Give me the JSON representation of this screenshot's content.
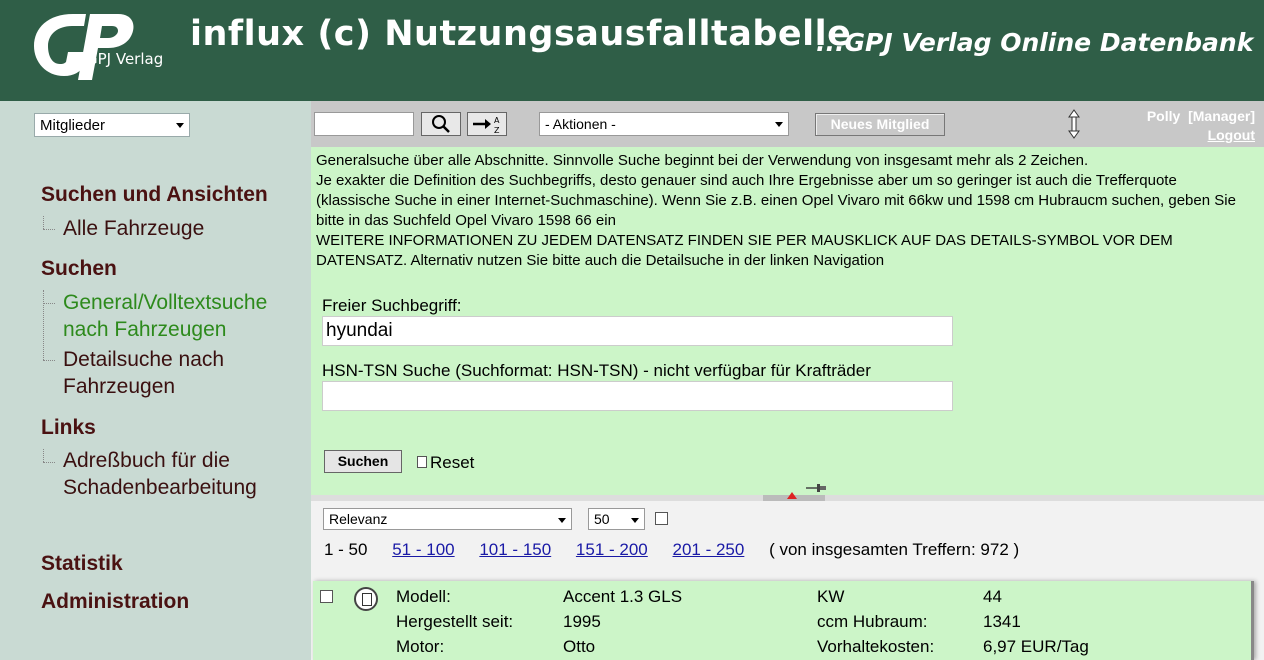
{
  "header": {
    "logo_text": "GPJ Verlag",
    "title": "influx (c) Nutzungsausfalltabelle",
    "subtitle": "...GPJ Verlag Online Datenbank"
  },
  "sidebar": {
    "members_select": "Mitglieder",
    "sections": [
      {
        "heading": "Suchen und Ansichten",
        "items": [
          "Alle Fahrzeuge"
        ]
      },
      {
        "heading": "Suchen",
        "items": [
          "General/Volltextsuche nach Fahrzeugen",
          "Detailsuche nach Fahrzeugen"
        ]
      },
      {
        "heading": "Links",
        "items": [
          "Adreßbuch für die Schadenbearbeitung"
        ]
      },
      {
        "heading": "Statistik",
        "items": []
      },
      {
        "heading": "Administration",
        "items": []
      }
    ]
  },
  "toolbar": {
    "search_value": "",
    "actions_select": "- Aktionen -",
    "new_member_label": "Neues Mitglied",
    "user_name": "Polly",
    "user_role": "[Manager]",
    "logout_label": "Logout"
  },
  "search": {
    "info_lines": [
      "Generalsuche über alle Abschnitte. Sinnvolle Suche beginnt bei der Verwendung von insgesamt mehr als 2 Zeichen.",
      "Je exakter die Definition des Suchbegriffs, desto genauer sind auch Ihre Ergebnisse aber um so geringer ist auch die Trefferquote (klassische Suche in einer Internet-Suchmaschine). Wenn Sie z.B. einen Opel Vivaro mit 66kw und 1598 cm Hubraucm suchen, geben Sie bitte in das Suchfeld Opel Vivaro 1598 66 ein",
      "WEITERE INFORMATIONEN ZU JEDEM DATENSATZ FINDEN SIE PER MAUSKLICK AUF DAS DETAILS-SYMBOL VOR DEM DATENSATZ. Alternativ nutzen Sie bitte auch die Detailsuche in der linken Navigation"
    ],
    "free_label": "Freier Suchbegriff:",
    "free_value": "hyundai",
    "hsn_label": "HSN-TSN Suche (Suchformat: HSN-TSN) - nicht verfügbar für Krafträder",
    "hsn_value": "",
    "submit_label": "Suchen",
    "reset_label": "Reset"
  },
  "results": {
    "sort_select": "Relevanz",
    "count_select": "50",
    "current_range": "1 - 50",
    "page_links": [
      "51 - 100",
      "101 - 150",
      "151 - 200",
      "201 - 250"
    ],
    "total_text": "( von insgesamten Treffern: 972 )",
    "first": {
      "modell_label": "Modell:",
      "modell": "Accent 1.3 GLS",
      "seit_label": "Hergestellt seit:",
      "seit": "1995",
      "motor_label": "Motor:",
      "motor": "Otto",
      "kw_label": "KW",
      "kw": "44",
      "ccm_label": "ccm Hubraum:",
      "ccm": "1341",
      "kosten_label": "Vorhaltekosten:",
      "kosten": "6,97 EUR/Tag"
    }
  },
  "colors": {
    "header_bg": "#2f5e47",
    "sidebar_bg": "#c9dad3",
    "content_bg": "#ccf5c8",
    "nav_heading": "#4a1212",
    "nav_active": "#2d8a1c",
    "link": "#1a1aa6"
  }
}
